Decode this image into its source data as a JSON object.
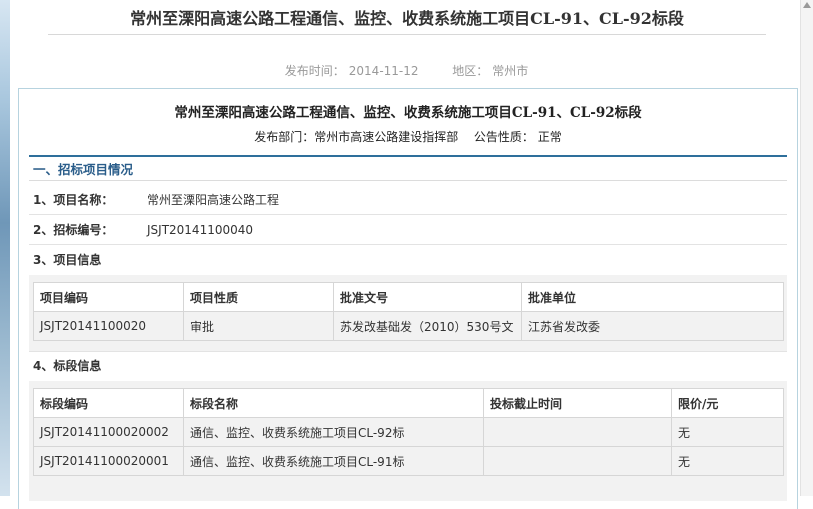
{
  "page": {
    "title": "常州至溧阳高速公路工程通信、监控、收费系统施工项目CL-91、CL-92标段",
    "meta": {
      "date_label": "发布时间：",
      "date": "2014-11-12",
      "region_label": "地区：",
      "region": "常州市"
    }
  },
  "doc": {
    "title": "常州至溧阳高速公路工程通信、监控、收费系统施工项目CL-91、CL-92标段",
    "dept_label": "发布部门：",
    "dept": "常州市高速公路建设指挥部",
    "nature_label": "公告性质：",
    "nature": "正常",
    "section1": "一、招标项目情况",
    "item1_label": "1、项目名称：",
    "item1_value": "常州至溧阳高速公路工程",
    "item2_label": "2、招标编号：",
    "item2_value": "JSJT20141100040",
    "item3_label": "3、项目信息",
    "project_table": {
      "headers": [
        "项目编码",
        "项目性质",
        "批准文号",
        "批准单位"
      ],
      "rows": [
        [
          "JSJT20141100020",
          "审批",
          "苏发改基础发（2010）530号文",
          "江苏省发改委"
        ]
      ]
    },
    "item4_label": "4、标段信息",
    "section_table": {
      "headers": [
        "标段编码",
        "标段名称",
        "投标截止时间",
        "限价/元"
      ],
      "rows": [
        [
          "JSJT20141100020002",
          "通信、监控、收费系统施工项目CL-92标",
          "",
          "无"
        ],
        [
          "JSJT20141100020001",
          "通信、监控、收费系统施工项目CL-91标",
          "",
          "无"
        ]
      ]
    }
  }
}
